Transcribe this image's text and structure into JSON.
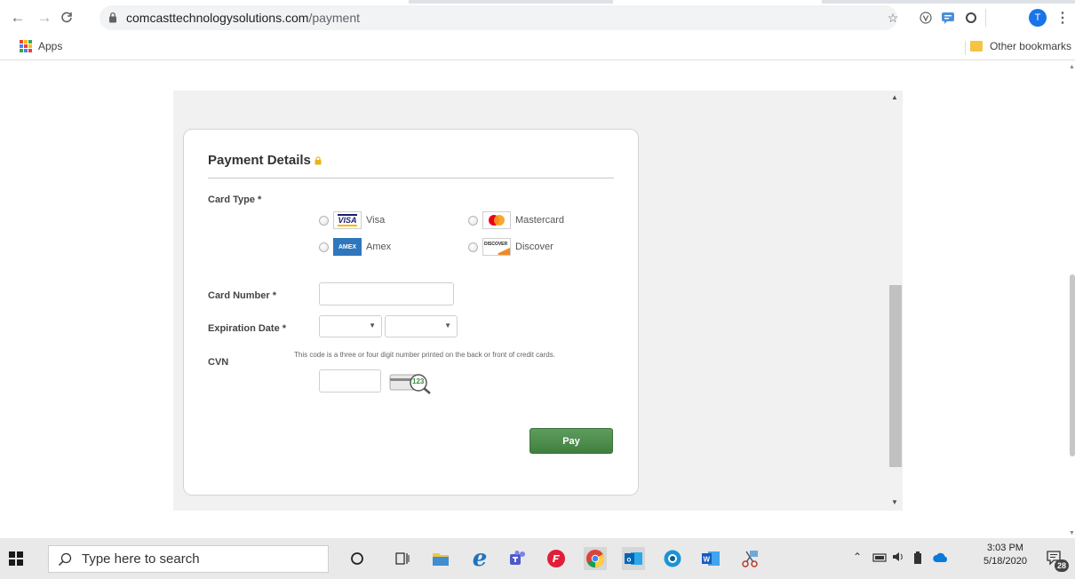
{
  "browser": {
    "url_domain": "comcasttechnologysolutions.com",
    "url_path": "/payment",
    "profile_initial": "T",
    "bookmarks": {
      "apps_label": "Apps",
      "other_label": "Other bookmarks"
    }
  },
  "payment_form": {
    "title": "Payment Details",
    "card_type_label": "Card Type *",
    "card_types": [
      {
        "label": "Visa",
        "logo_text": "VISA"
      },
      {
        "label": "Mastercard",
        "logo_text": ""
      },
      {
        "label": "Amex",
        "logo_text": "AMEX"
      },
      {
        "label": "Discover",
        "logo_text": "DISCOVER"
      }
    ],
    "card_number_label": "Card Number *",
    "card_number_value": "",
    "expiration_label": "Expiration Date *",
    "expiration_month": "",
    "expiration_year": "",
    "cvn_label": "CVN",
    "cvn_help": "This code is a three or four digit number printed on the back or front of credit cards.",
    "cvn_value": "",
    "cvn_image_text": "123",
    "pay_label": "Pay"
  },
  "taskbar": {
    "search_placeholder": "Type here to search",
    "time": "3:03 PM",
    "date": "5/18/2020",
    "notification_count": "28"
  },
  "colors": {
    "pay_button": "#4a8a4a",
    "frame_bg": "#f1f1f1",
    "profile": "#1a73e8",
    "visa_blue": "#1a1f71",
    "amex_blue": "#2e77bc",
    "discover_orange": "#f08a24"
  }
}
